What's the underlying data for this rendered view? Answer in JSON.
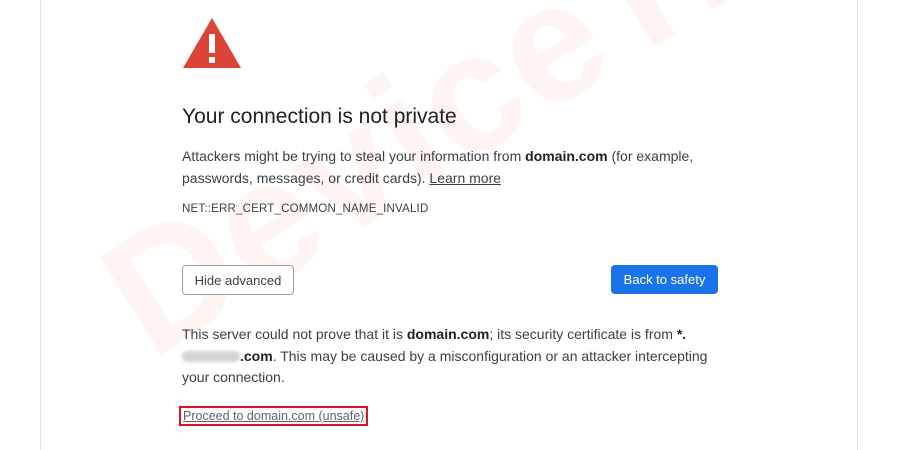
{
  "watermark": "DeviceTricks",
  "colors": {
    "warning_icon": "#db4437",
    "primary_button": "#1a73e8",
    "highlight_box": "#e0141e"
  },
  "icon": "warning-triangle-icon",
  "title": "Your connection is not private",
  "intro": {
    "before": "Attackers might be trying to steal your information from ",
    "domain": "domain.com",
    "after": " (for example, passwords, messages, or credit cards). ",
    "learn_more": "Learn more"
  },
  "error_code": "NET::ERR_CERT_COMMON_NAME_INVALID",
  "buttons": {
    "hide_advanced": "Hide advanced",
    "back_to_safety": "Back to safety"
  },
  "details": {
    "before": "This server could not prove that it is ",
    "domain": "domain.com",
    "middle": "; its security certificate is from ",
    "cert_prefix": "*.",
    "cert_suffix": ".com",
    "after": ". This may be caused by a misconfiguration or an attacker intercepting your connection."
  },
  "proceed_link": "Proceed to domain.com (unsafe)"
}
